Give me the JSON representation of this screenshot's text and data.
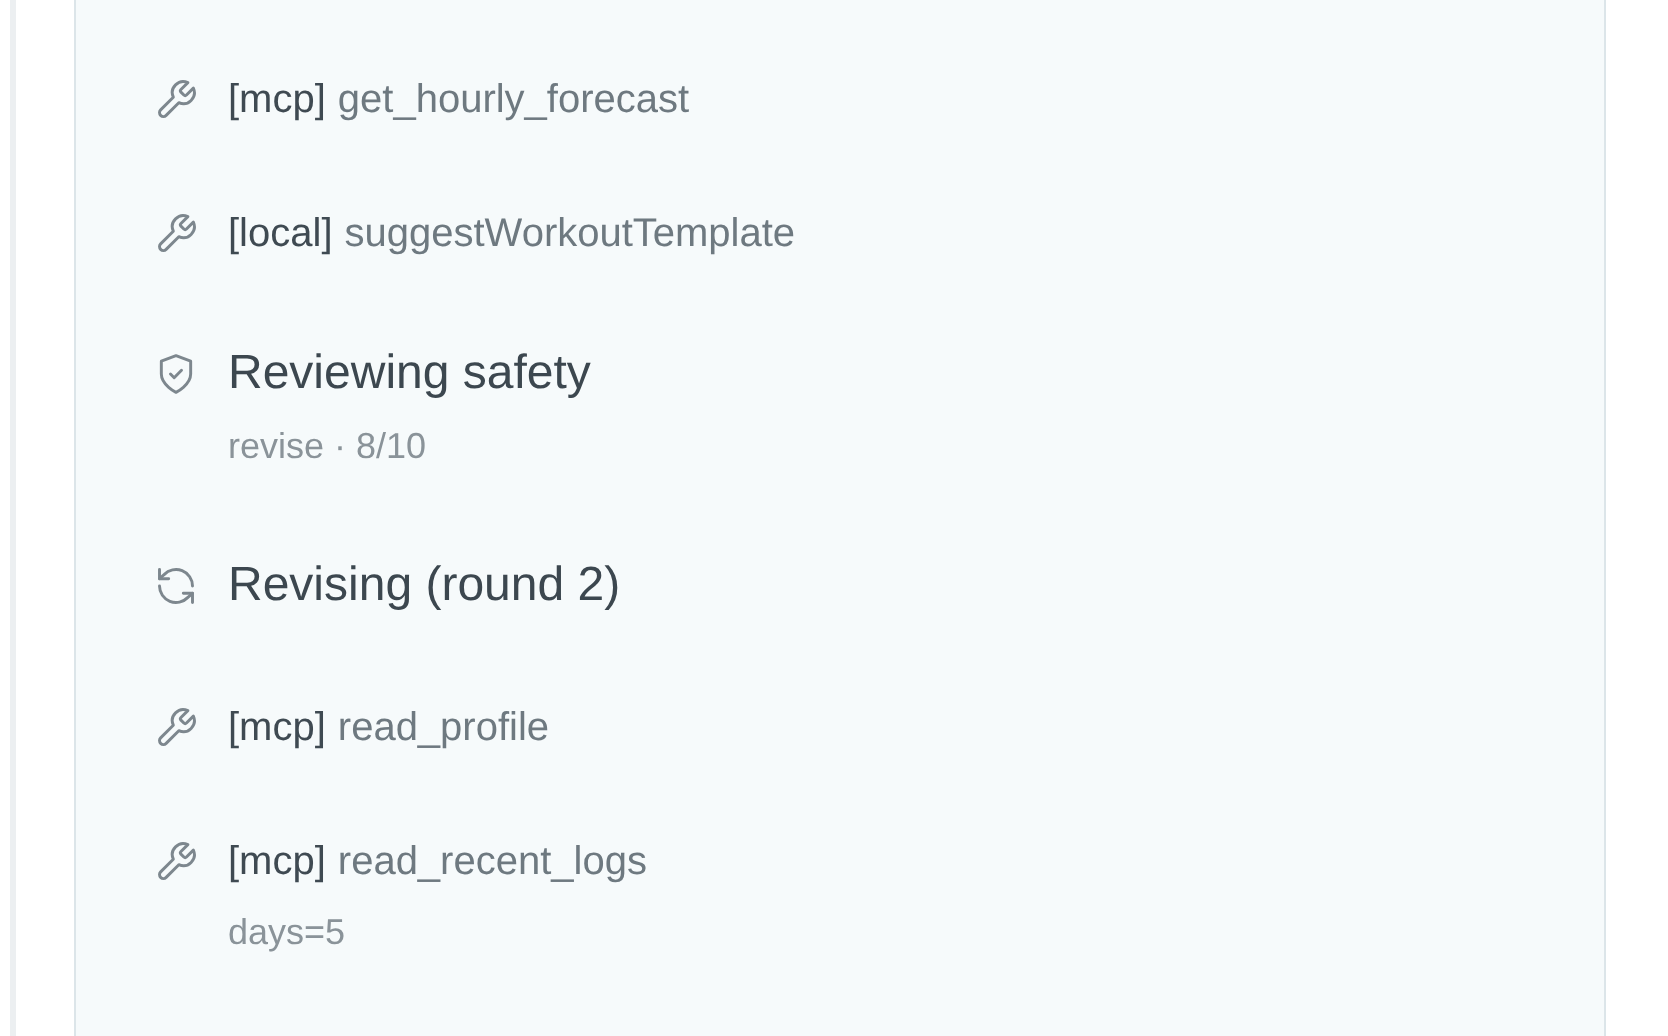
{
  "steps": [
    {
      "kind": "tool",
      "tag": "[mcp]",
      "name": "get_hourly_forecast"
    },
    {
      "kind": "tool",
      "tag": "[local]",
      "name": "suggestWorkoutTemplate"
    },
    {
      "kind": "review",
      "title": "Reviewing safety",
      "detail": "revise · 8/10"
    },
    {
      "kind": "revise",
      "title": "Revising (round 2)"
    },
    {
      "kind": "tool",
      "tag": "[mcp]",
      "name": "read_profile"
    },
    {
      "kind": "tool",
      "tag": "[mcp]",
      "name": "read_recent_logs",
      "detail": "days=5"
    }
  ]
}
